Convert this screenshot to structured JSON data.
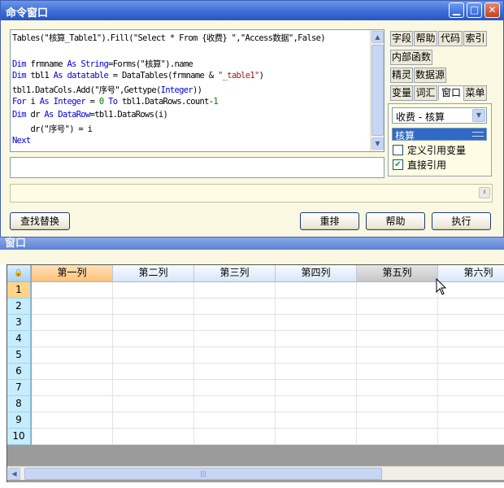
{
  "command_window": {
    "title": "命令窗口",
    "code_lines": [
      [
        {
          "t": "Tables(\"核算_Table1\").Fill(\"Select * From {收费} \",\"Access数据\",False)",
          "c": ""
        }
      ],
      [
        {
          "t": "",
          "c": ""
        }
      ],
      [
        {
          "t": "Dim",
          "c": "kw"
        },
        {
          "t": " frmname ",
          "c": ""
        },
        {
          "t": "As String",
          "c": "kw"
        },
        {
          "t": "=Forms(\"核算\").name",
          "c": ""
        }
      ],
      [
        {
          "t": "Dim",
          "c": "kw"
        },
        {
          "t": " tbl1 ",
          "c": ""
        },
        {
          "t": "As datatable",
          "c": "kw"
        },
        {
          "t": " = DataTables(frmname & ",
          "c": ""
        },
        {
          "t": "\"_table1\"",
          "c": "str"
        },
        {
          "t": ")",
          "c": ""
        }
      ],
      [
        {
          "t": "tbl1.DataCols.Add(\"序号\",Gettype(",
          "c": ""
        },
        {
          "t": "Integer",
          "c": "kw"
        },
        {
          "t": "))",
          "c": ""
        }
      ],
      [
        {
          "t": "For",
          "c": "kw"
        },
        {
          "t": " i ",
          "c": ""
        },
        {
          "t": "As Integer",
          "c": "kw"
        },
        {
          "t": " = ",
          "c": ""
        },
        {
          "t": "0",
          "c": "num"
        },
        {
          "t": " ",
          "c": ""
        },
        {
          "t": "To",
          "c": "kw"
        },
        {
          "t": " tbl1.DataRows.count-",
          "c": ""
        },
        {
          "t": "1",
          "c": "num"
        }
      ],
      [
        {
          "t": "Dim",
          "c": "kw"
        },
        {
          "t": " dr ",
          "c": ""
        },
        {
          "t": "As DataRow",
          "c": "kw"
        },
        {
          "t": "=tbl1.DataRows(i)",
          "c": ""
        }
      ],
      [
        {
          "t": "    dr(\"序号\") = i",
          "c": ""
        }
      ],
      [
        {
          "t": "Next",
          "c": "kw"
        }
      ]
    ],
    "tabs_row1": [
      "字段",
      "帮助",
      "代码",
      "索引"
    ],
    "tabs_row2": [
      "内部函数"
    ],
    "tabs_row3": [
      "精灵",
      "数据源"
    ],
    "tabs_row4": [
      "变量",
      "词汇",
      "窗口",
      "菜单"
    ],
    "active_tab": "窗口",
    "form_selector_value": "收费 - 核算",
    "selected_item": "核算",
    "checkbox_define_ref": {
      "label": "定义引用变量",
      "checked": false
    },
    "checkbox_direct_ref": {
      "label": "直接引用",
      "checked": true
    },
    "buttons": {
      "find_replace": "查找替换",
      "reorder": "重排",
      "help": "帮助",
      "run": "执行"
    },
    "colors": {
      "title_blue": "#3a6ad4",
      "panel": "#fbf8e2",
      "keyword": "#0000dd"
    }
  },
  "data_window": {
    "title": "窗口",
    "columns": [
      "第一列",
      "第二列",
      "第三列",
      "第四列",
      "第五列",
      "第六列"
    ],
    "selected_column": "第一列",
    "hovered_column": "第五列",
    "rows": [
      "1",
      "2",
      "3",
      "4",
      "5",
      "6",
      "7",
      "8",
      "9",
      "10"
    ],
    "selected_row": "1",
    "corner_icon": "lock-icon"
  }
}
